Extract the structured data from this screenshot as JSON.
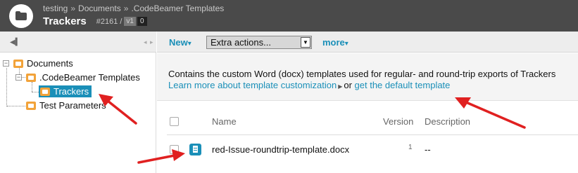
{
  "header": {
    "breadcrumb": [
      "testing",
      "Documents",
      ".CodeBeamer Templates"
    ],
    "breadcrumb_sep": "»",
    "title": "Trackers",
    "issue_id": "#2161",
    "slash": "/",
    "version_badge": "v1",
    "count_badge": "0",
    "icon": "folder-icon"
  },
  "left_panel": {
    "collapse_icon": "collapse-left-icon",
    "arrows": "◂ ▸",
    "tree": [
      {
        "label": "Documents",
        "toggle": "−"
      },
      {
        "label": ".CodeBeamer Templates",
        "toggle": "−"
      },
      {
        "label": "Trackers",
        "selected": true
      },
      {
        "label": "Test Parameters"
      }
    ]
  },
  "toolbar": {
    "new_label": "New",
    "caret": "▾",
    "select_value": "Extra actions...",
    "select_arrow": "▼",
    "more_label": "more"
  },
  "info": {
    "description": "Contains the custom Word (docx) templates used for regular- and round-trip exports of Trackers",
    "learn_more": "Learn more about template customization",
    "or_text": "or",
    "default_link": "get the default template"
  },
  "table": {
    "columns": {
      "name": "Name",
      "version": "Version",
      "description": "Description"
    },
    "rows": [
      {
        "name": "red-Issue-roundtrip-template.docx",
        "version": "1",
        "description": "--",
        "icon": "docx-file-icon"
      }
    ]
  },
  "colors": {
    "header_bg": "#4a4a4a",
    "link": "#1a8fb8",
    "folder": "#f2a33a",
    "annotation_arrow": "#e02020"
  }
}
